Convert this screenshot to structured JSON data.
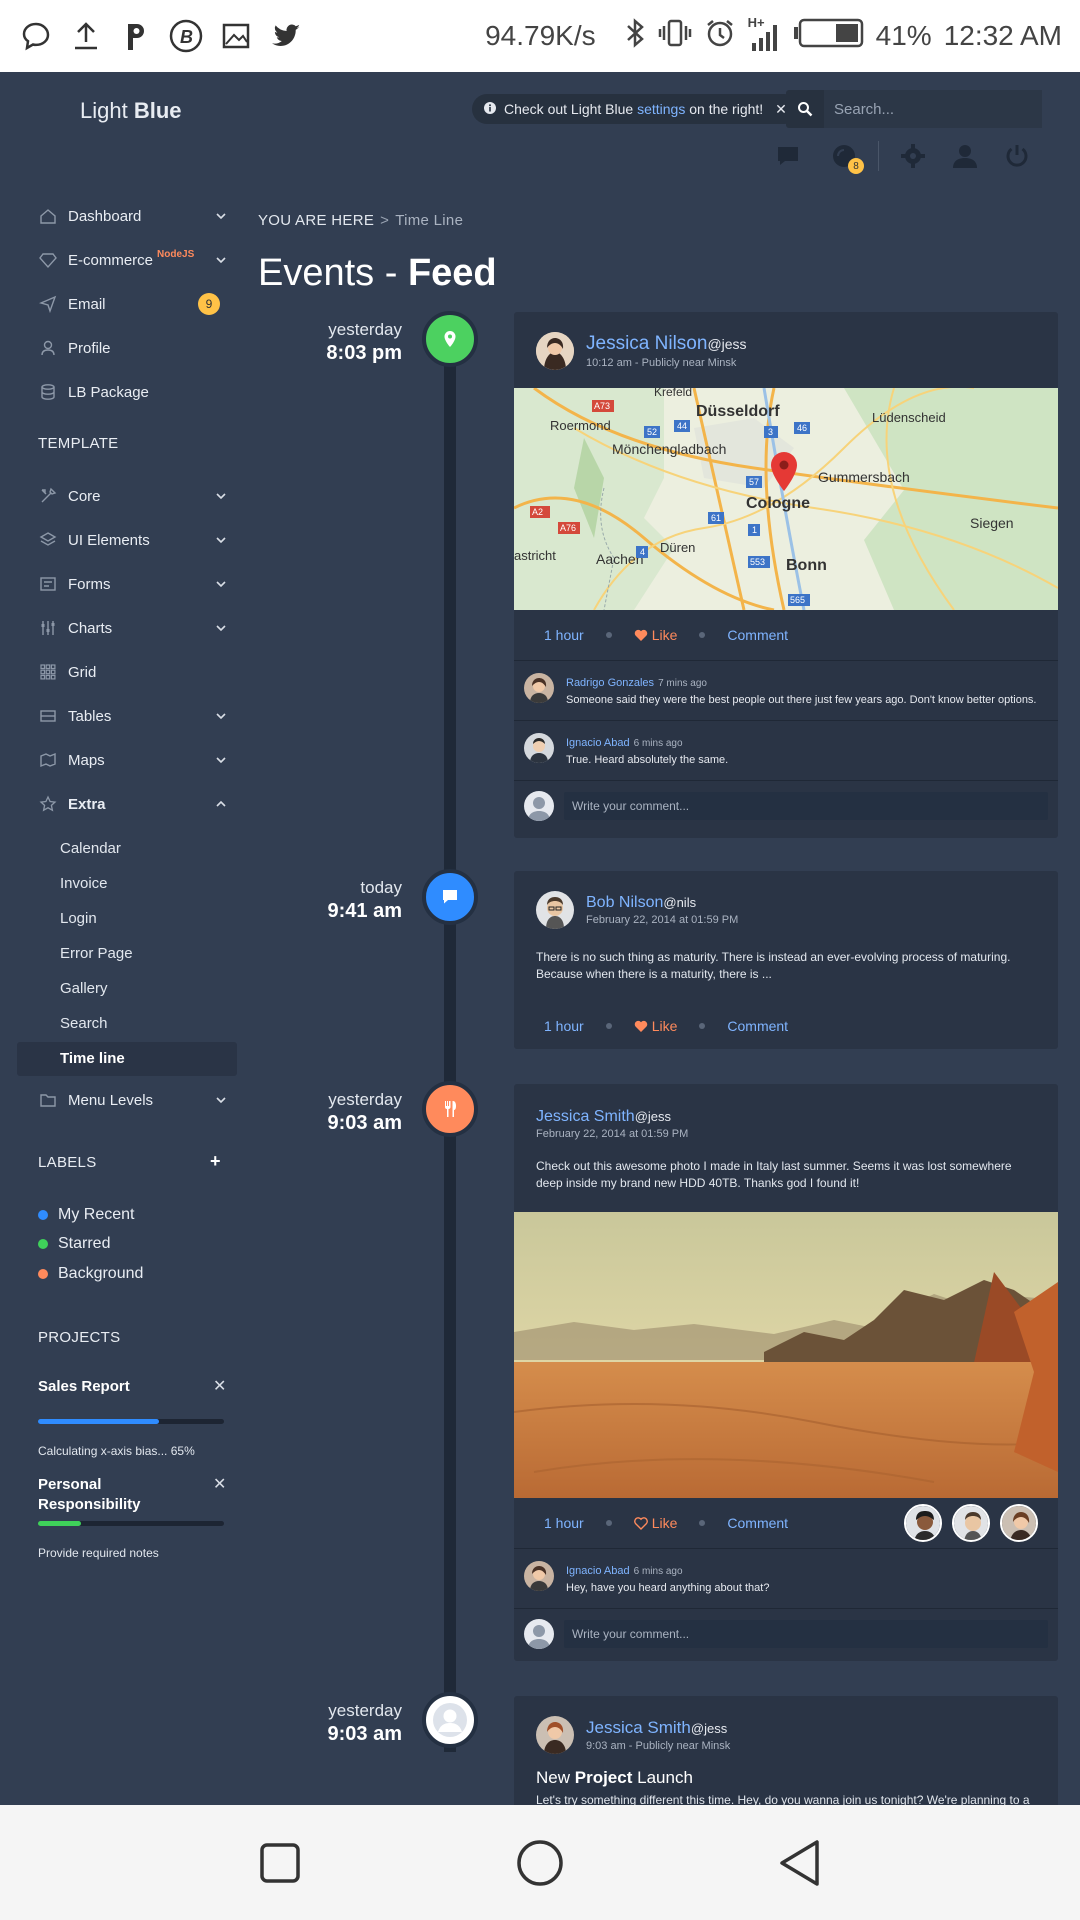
{
  "status_bar": {
    "network_speed": "94.79K/s",
    "signal": "H+",
    "battery": "41%",
    "time": "12:32 AM",
    "icons": [
      "chat-bubble-icon",
      "upload-icon",
      "p-icon",
      "b-icon",
      "image-icon",
      "twitter-icon",
      "bluetooth-icon",
      "vibrate-icon",
      "alarm-icon",
      "signal-icon",
      "battery-icon"
    ]
  },
  "header": {
    "logo_light": "Light",
    "logo_bold": "Blue",
    "notice_text": "Check out Light Blue",
    "notice_link": "settings",
    "notice_suffix": "on the right!",
    "search_placeholder": "Search...",
    "notifications_badge": "8"
  },
  "sidebar": {
    "items": [
      {
        "label": "Dashboard"
      },
      {
        "label": "E-commerce",
        "sup": "NodeJS"
      },
      {
        "label": "Email",
        "badge": "9"
      },
      {
        "label": "Profile"
      },
      {
        "label": "LB Package"
      }
    ],
    "template_title": "TEMPLATE",
    "template_items": [
      {
        "label": "Core"
      },
      {
        "label": "UI Elements"
      },
      {
        "label": "Forms"
      },
      {
        "label": "Charts"
      },
      {
        "label": "Grid"
      },
      {
        "label": "Tables"
      },
      {
        "label": "Maps"
      },
      {
        "label": "Extra"
      }
    ],
    "extra_sub": [
      "Calendar",
      "Invoice",
      "Login",
      "Error Page",
      "Gallery",
      "Search",
      "Time line"
    ],
    "menu_levels": "Menu Levels",
    "labels_title": "LABELS",
    "labels": [
      {
        "label": "My Recent",
        "color": "#2f8cff"
      },
      {
        "label": "Starred",
        "color": "#3fd15a"
      },
      {
        "label": "Background",
        "color": "#ff8a5c"
      }
    ],
    "projects_title": "PROJECTS",
    "projects": [
      {
        "name": "Sales Report",
        "progress": 0.65,
        "color": "#2f8cff",
        "note": "Calculating x-axis bias... 65%"
      },
      {
        "name": "Personal Responsibility",
        "progress": 0.23,
        "color": "#3fd15a",
        "note": "Provide required notes"
      }
    ]
  },
  "breadcrumb": {
    "prefix": "YOU ARE HERE",
    "current": "Time Line"
  },
  "page_title": {
    "light": "Events -",
    "bold": "Feed"
  },
  "events": [
    {
      "day": "yesterday",
      "hour": "8:03 pm",
      "icon_color": "#4cd160",
      "icon": "map-pin-icon",
      "user": "Jessica Nilson",
      "handle": "@jess",
      "meta": "10:12 am - Publicly near Minsk",
      "map_labels": [
        "Krefeld",
        "Düsseldorf",
        "Roermond",
        "Mönchengladbach",
        "Lüdenscheid",
        "Gummersbach",
        "Cologne",
        "Siegen",
        "Aachen",
        "Düren",
        "Bonn",
        "astricht"
      ],
      "road_labels": [
        "A73",
        "52",
        "44",
        "3",
        "46",
        "57",
        "A2",
        "A76",
        "61",
        "1",
        "4",
        "553",
        "565"
      ],
      "actions": {
        "time": "1 hour",
        "like": "Like",
        "comment": "Comment"
      },
      "comments": [
        {
          "name": "Radrigo Gonzales",
          "time": "7 mins ago",
          "text": "Someone said they were the best people out there just few years ago. Don't know better options."
        },
        {
          "name": "Ignacio Abad",
          "time": "6 mins ago",
          "text": "True. Heard absolutely the same."
        }
      ],
      "write_placeholder": "Write your comment..."
    },
    {
      "day": "today",
      "hour": "9:41 am",
      "icon_color": "#2f8cff",
      "icon": "chat-icon",
      "user": "Bob Nilson",
      "handle": "@nils",
      "meta": "February 22, 2014 at 01:59 PM",
      "text": "There is no such thing as maturity. There is instead an ever-evolving process of maturing. Because when there is a maturity, there is ...",
      "actions": {
        "time": "1 hour",
        "like": "Like",
        "comment": "Comment"
      }
    },
    {
      "day": "yesterday",
      "hour": "9:03 am",
      "icon_color": "#ff8a5c",
      "icon": "cutlery-icon",
      "user": "Jessica Smith",
      "handle": "@jess",
      "meta": "February 22, 2014 at 01:59 PM",
      "text": "Check out this awesome photo I made in Italy last summer. Seems it was lost somewhere deep inside my brand new HDD 40TB. Thanks god I found it!",
      "actions": {
        "time": "1 hour",
        "like": "Like",
        "comment": "Comment"
      },
      "comments": [
        {
          "name": "Ignacio Abad",
          "time": "6 mins ago",
          "text": "Hey, have you heard anything about that?"
        }
      ],
      "write_placeholder": "Write your comment..."
    },
    {
      "day": "yesterday",
      "hour": "9:03 am",
      "icon_color": "#ffffff",
      "icon": "user-icon",
      "user": "Jessica Smith",
      "handle": "@jess",
      "meta": "9:03 am - Publicly near Minsk",
      "title_light": "New",
      "title_bold": "Project",
      "title_end": "Launch",
      "text": "Let's try something different this time. Hey, do you wanna join us tonight? We're planning to a"
    }
  ],
  "nav_buttons": [
    "square-icon",
    "circle-icon",
    "back-triangle-icon"
  ]
}
